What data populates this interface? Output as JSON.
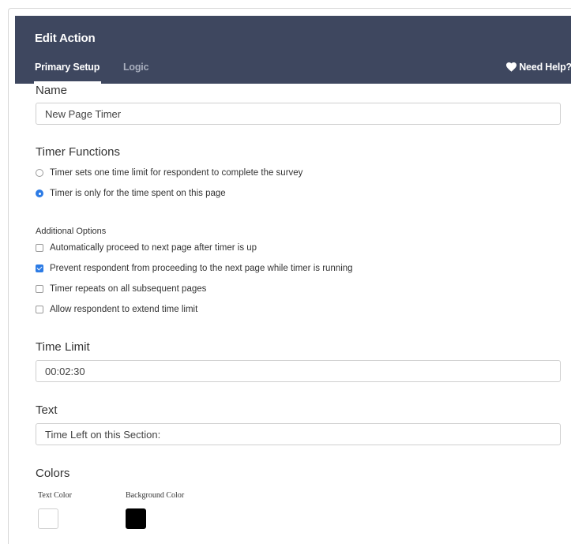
{
  "header": {
    "title": "Edit Action",
    "tabs": [
      {
        "label": "Primary Setup",
        "active": true
      },
      {
        "label": "Logic",
        "active": false
      }
    ],
    "help_label": "Need Help?"
  },
  "name": {
    "label": "Name",
    "value": "New Page Timer"
  },
  "timer_functions": {
    "label": "Timer Functions",
    "options": [
      {
        "label": "Timer sets one time limit for respondent to complete the survey",
        "selected": false
      },
      {
        "label": "Timer is only for the time spent on this page",
        "selected": true
      }
    ]
  },
  "additional_options": {
    "label": "Additional Options",
    "options": [
      {
        "label": "Automatically proceed to next page after timer is up",
        "checked": false
      },
      {
        "label": "Prevent respondent from proceeding to the next page while timer is running",
        "checked": true
      },
      {
        "label": "Timer repeats on all subsequent pages",
        "checked": false
      },
      {
        "label": "Allow respondent to extend time limit",
        "checked": false
      }
    ]
  },
  "time_limit": {
    "label": "Time Limit",
    "value": "00:02:30"
  },
  "text": {
    "label": "Text",
    "value": "Time Left on this Section:"
  },
  "colors": {
    "label": "Colors",
    "text_color_label": "Text Color",
    "text_color": "#ffffff",
    "background_color_label": "Background Color",
    "background_color": "#000000"
  },
  "accent_color": "#2c7be5",
  "header_color": "#3e475f"
}
